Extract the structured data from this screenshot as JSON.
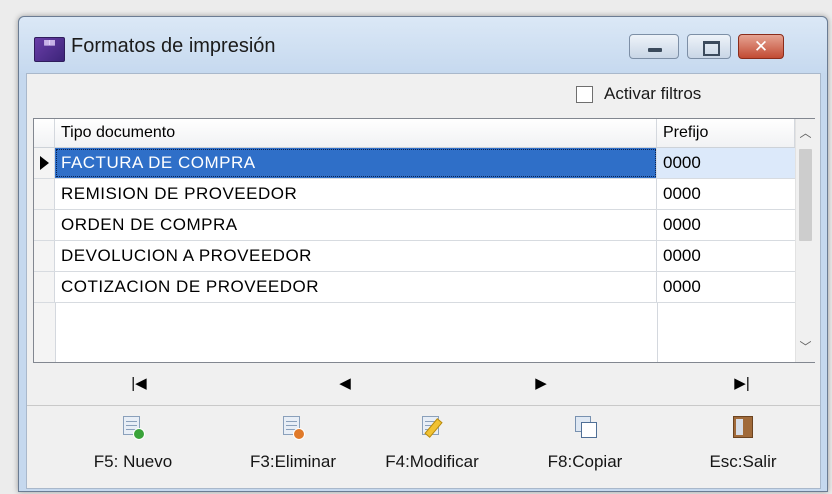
{
  "window": {
    "title": "Formatos de impresión",
    "app_icon_text": "▦▦",
    "controls": {
      "minimize": "minimize",
      "maximize": "maximize",
      "close": "✕"
    }
  },
  "filters": {
    "activar_filtros_label": "Activar filtros",
    "activar_filtros_checked": false
  },
  "grid": {
    "columns": [
      "Tipo documento",
      "Prefijo"
    ],
    "rows": [
      {
        "tipo": "FACTURA DE COMPRA",
        "prefijo": "0000",
        "selected": true
      },
      {
        "tipo": "REMISION DE PROVEEDOR",
        "prefijo": "0000",
        "selected": false
      },
      {
        "tipo": "ORDEN DE COMPRA",
        "prefijo": "0000",
        "selected": false
      },
      {
        "tipo": "DEVOLUCION A PROVEEDOR",
        "prefijo": "0000",
        "selected": false
      },
      {
        "tipo": "COTIZACION DE PROVEEDOR",
        "prefijo": "0000",
        "selected": false
      }
    ]
  },
  "navigator": {
    "first": "|◀",
    "prev": "◀",
    "next": "▶",
    "last": "▶|"
  },
  "actions": {
    "nuevo": "F5: Nuevo",
    "eliminar": "F3:Eliminar",
    "modificar": "F4:Modificar",
    "copiar": "F8:Copiar",
    "salir": "Esc:Salir"
  },
  "icons": {
    "app": "app-icon",
    "minimize": "minimize-icon",
    "maximize": "maximize-icon",
    "close": "close-icon",
    "nuevo": "new-document-icon",
    "eliminar": "delete-document-icon",
    "modificar": "edit-document-icon",
    "copiar": "copy-icon",
    "salir": "exit-door-icon"
  },
  "colors": {
    "selection": "#2f6fc8",
    "titlebar": "#c6d9ef",
    "close_button": "#c24b34"
  }
}
